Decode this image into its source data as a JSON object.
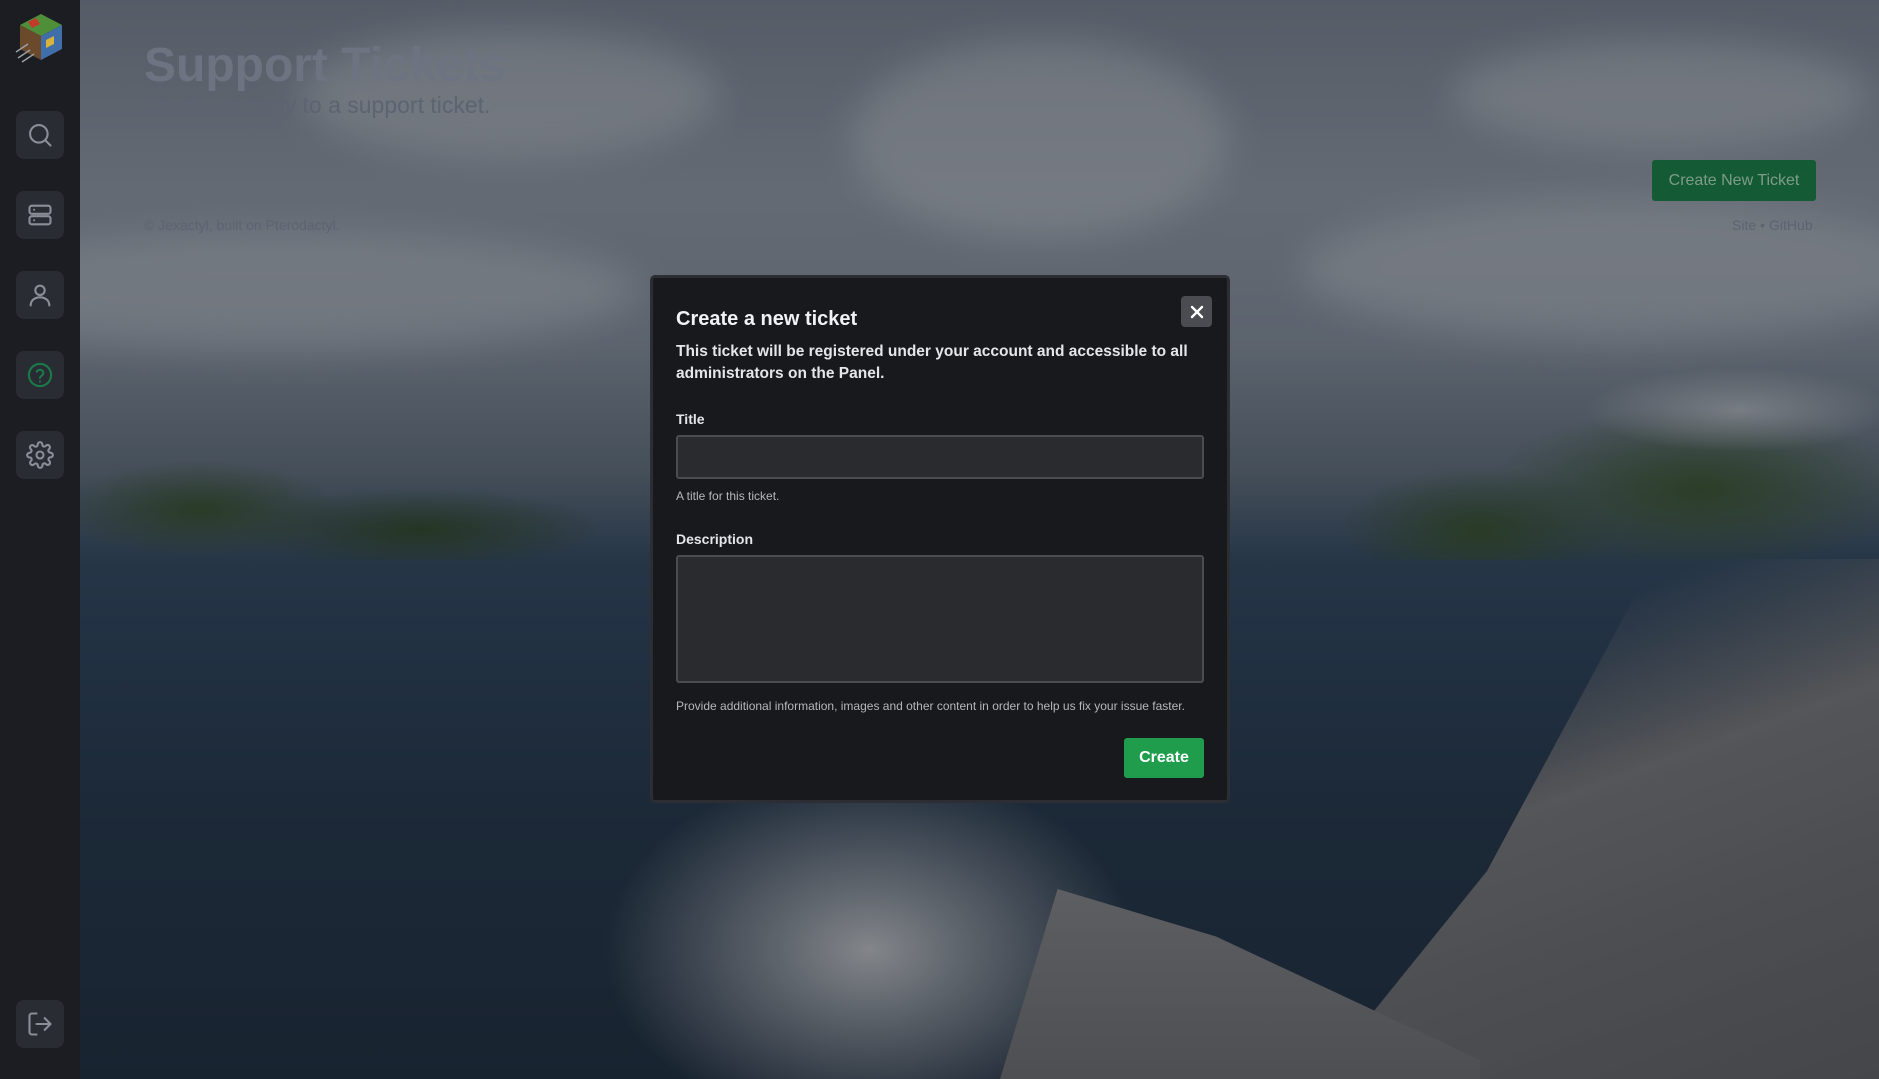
{
  "sidebar": {
    "logo_icon": "cube-logo-icon",
    "items": [
      {
        "icon": "search-icon",
        "active": false
      },
      {
        "icon": "server-icon",
        "active": false
      },
      {
        "icon": "user-icon",
        "active": false
      },
      {
        "icon": "help-circle-icon",
        "active": true
      },
      {
        "icon": "gear-icon",
        "active": false
      }
    ],
    "logout_icon": "logout-icon"
  },
  "header": {
    "title": "Support Tickets",
    "subtitle": "Create or reply to a support ticket."
  },
  "actions": {
    "create_new_ticket": "Create New Ticket"
  },
  "footer": {
    "copyright": "© Jexactyl, built on Pterodactyl.",
    "links": [
      "Site",
      "•",
      "GitHub"
    ]
  },
  "modal": {
    "title": "Create a new ticket",
    "description": "This ticket will be registered under your account and accessible to all administrators on the Panel.",
    "fields": {
      "title": {
        "label": "Title",
        "value": "",
        "helper": "A title for this ticket."
      },
      "description": {
        "label": "Description",
        "value": "",
        "helper": "Provide additional information, images and other content in order to help us fix your issue faster."
      }
    },
    "submit_label": "Create",
    "close_icon": "close-icon"
  },
  "colors": {
    "accent": "#1f9d4c",
    "sidebar_bg": "#1c1d22",
    "modal_bg": "#18191d",
    "active_icon": "#1a7a4a"
  }
}
